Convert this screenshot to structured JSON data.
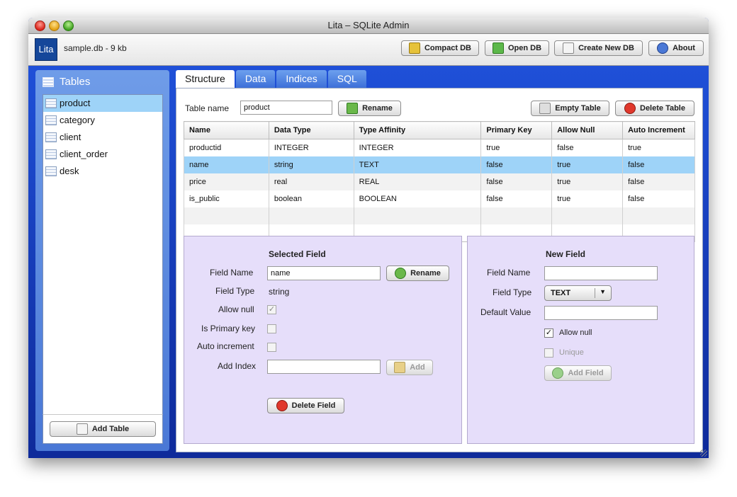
{
  "window": {
    "title": "Lita – SQLite Admin"
  },
  "toolbar": {
    "logo": "Lita",
    "db_info": "sample.db - 9 kb",
    "compact_label": "Compact DB",
    "open_label": "Open DB",
    "create_label": "Create New DB",
    "about_label": "About"
  },
  "sidebar": {
    "title": "Tables",
    "items": [
      {
        "label": "product"
      },
      {
        "label": "category"
      },
      {
        "label": "client"
      },
      {
        "label": "client_order"
      },
      {
        "label": "desk"
      }
    ],
    "selected": "product",
    "add_table_label": "Add Table"
  },
  "tabs": [
    {
      "label": "Structure"
    },
    {
      "label": "Data"
    },
    {
      "label": "Indices"
    },
    {
      "label": "SQL"
    }
  ],
  "structure": {
    "table_name_label": "Table name",
    "table_name_value": "product",
    "rename_label": "Rename",
    "empty_table_label": "Empty Table",
    "delete_table_label": "Delete Table",
    "columns": [
      "Name",
      "Data Type",
      "Type Affinity",
      "Primary Key",
      "Allow Null",
      "Auto Increment"
    ],
    "rows": [
      [
        "productid",
        "INTEGER",
        "INTEGER",
        "true",
        "false",
        "true"
      ],
      [
        "name",
        "string",
        "TEXT",
        "false",
        "true",
        "false"
      ],
      [
        "price",
        "real",
        "REAL",
        "false",
        "true",
        "false"
      ],
      [
        "is_public",
        "boolean",
        "BOOLEAN",
        "false",
        "true",
        "false"
      ]
    ],
    "selected_row": "name"
  },
  "selected_field": {
    "title": "Selected Field",
    "field_name_label": "Field Name",
    "field_name_value": "name",
    "rename_label": "Rename",
    "field_type_label": "Field Type",
    "field_type_value": "string",
    "allow_null_label": "Allow null",
    "is_primary_key_label": "Is Primary key",
    "auto_increment_label": "Auto increment",
    "add_index_label": "Add Index",
    "add_label": "Add",
    "delete_field_label": "Delete Field"
  },
  "new_field": {
    "title": "New Field",
    "field_name_label": "Field Name",
    "field_type_label": "Field Type",
    "field_type_value": "TEXT",
    "default_value_label": "Default Value",
    "allow_null_label": "Allow null",
    "unique_label": "Unique",
    "add_field_label": "Add Field"
  },
  "colors": {
    "accent_blue": "#1f50d8",
    "selection": "#9ed3f8",
    "panel_bg": "#e6defa"
  }
}
